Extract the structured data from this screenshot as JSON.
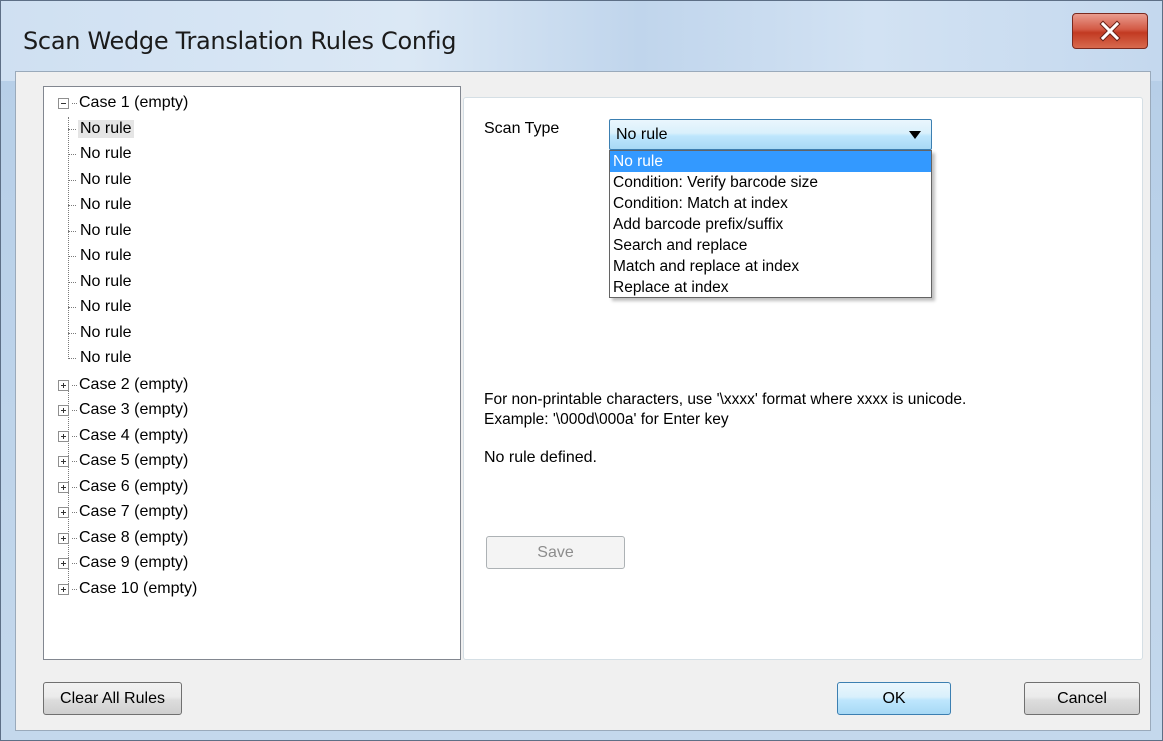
{
  "window": {
    "title": "Scan Wedge Translation Rules Config"
  },
  "tree": {
    "case1_label": "Case 1 (empty)",
    "rules": [
      "No rule",
      "No rule",
      "No rule",
      "No rule",
      "No rule",
      "No rule",
      "No rule",
      "No rule",
      "No rule",
      "No rule"
    ],
    "cases": [
      "Case 2 (empty)",
      "Case 3 (empty)",
      "Case 4 (empty)",
      "Case 5 (empty)",
      "Case 6 (empty)",
      "Case 7 (empty)",
      "Case 8 (empty)",
      "Case 9 (empty)",
      "Case 10 (empty)"
    ]
  },
  "panel": {
    "scan_type_label": "Scan Type",
    "scan_type_value": "No rule",
    "options": [
      "No rule",
      "Condition: Verify barcode size",
      "Condition: Match at index",
      "Add barcode prefix/suffix",
      "Search and replace",
      "Match and replace at index",
      "Replace at index"
    ],
    "hint_line1": "For non-printable characters, use '\\xxxx' format where xxxx is unicode.",
    "hint_line2": "Example: '\\000d\\000a' for Enter key",
    "status": "No rule defined.",
    "save_label": "Save"
  },
  "footer": {
    "clear_label": "Clear All Rules",
    "ok_label": "OK",
    "cancel_label": "Cancel"
  }
}
